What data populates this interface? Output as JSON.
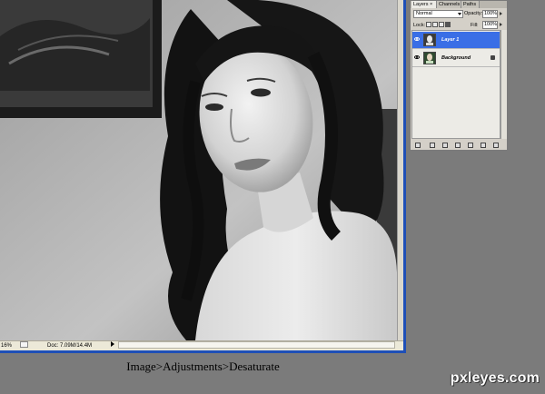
{
  "document": {
    "status_zoom": "16%",
    "status_doc": "Doc: 7.09M/14.4M"
  },
  "layers_panel": {
    "tabs": [
      {
        "label": "Layers ×"
      },
      {
        "label": "Channels"
      },
      {
        "label": "Paths"
      }
    ],
    "blend_mode": "Normal",
    "opacity_label": "Opacity:",
    "opacity_value": "100%",
    "lock_label": "Lock:",
    "fill_label": "Fill:",
    "fill_value": "100%",
    "layers": [
      {
        "name": "Layer 1",
        "selected": true
      },
      {
        "name": "Background",
        "locked": true
      }
    ],
    "selection_color": "#3a6ee6"
  },
  "caption": "Image>Adjustments>Desaturate",
  "watermark": "pxleyes.com"
}
